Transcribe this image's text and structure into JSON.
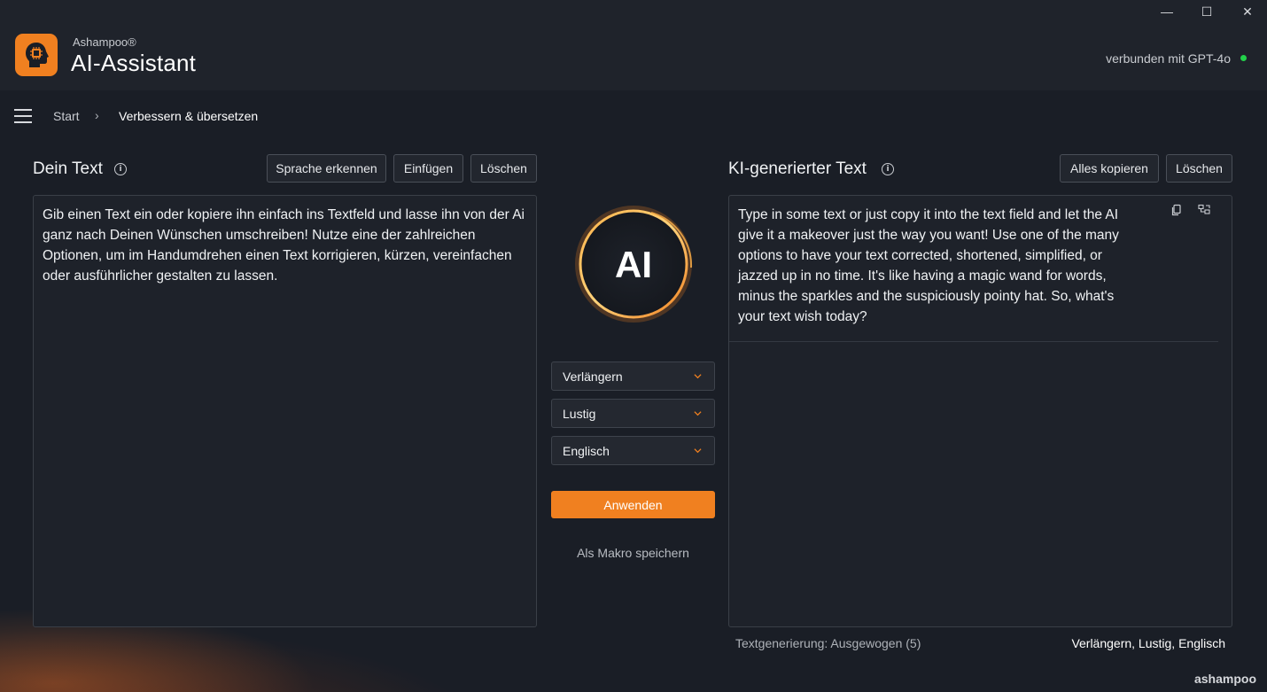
{
  "window": {
    "minimize_glyph": "—",
    "maximize_glyph": "☐",
    "close_glyph": "✕"
  },
  "header": {
    "brand_small": "Ashampoo®",
    "brand_big": "AI-Assistant",
    "connection_status": "verbunden mit GPT-4o",
    "status_color": "#22d14a",
    "accent_color": "#f08020"
  },
  "breadcrumb": {
    "start": "Start",
    "separator": "›",
    "current": "Verbessern & übersetzen"
  },
  "left_panel": {
    "title": "Dein Text",
    "info_glyph": "i",
    "buttons": {
      "detect_language": "Sprache erkennen",
      "paste": "Einfügen",
      "clear": "Löschen"
    },
    "text": "Gib einen Text ein oder kopiere ihn einfach ins Textfeld und lasse ihn von der Ai ganz nach Deinen Wünschen umschreiben! Nutze eine der zahlreichen Optionen, um im Handumdrehen einen Text korrigieren, kürzen, vereinfachen oder ausführlicher gestalten zu lassen."
  },
  "center": {
    "orb_label": "AI",
    "dropdowns": {
      "mode": "Verlängern",
      "tone": "Lustig",
      "language": "Englisch"
    },
    "apply_label": "Anwenden",
    "macro_label": "Als Makro speichern"
  },
  "right_panel": {
    "title": "KI-generierter Text",
    "info_glyph": "i",
    "buttons": {
      "copy_all": "Alles kopieren",
      "clear": "Löschen"
    },
    "output_text": "Type in some text or just copy it into the text field and let the AI give it a makeover just the way you want! Use one of the many options to have your text corrected, shortened, simplified, or jazzed up in no time. It's like having a magic wand for words, minus the sparkles and the suspiciously pointy hat. So, what's your text wish today?",
    "footer_left": "Textgenerierung: Ausgewogen (5)",
    "footer_right": "Verlängern, Lustig, Englisch"
  },
  "footer": {
    "logo_text": "ashampoo"
  }
}
